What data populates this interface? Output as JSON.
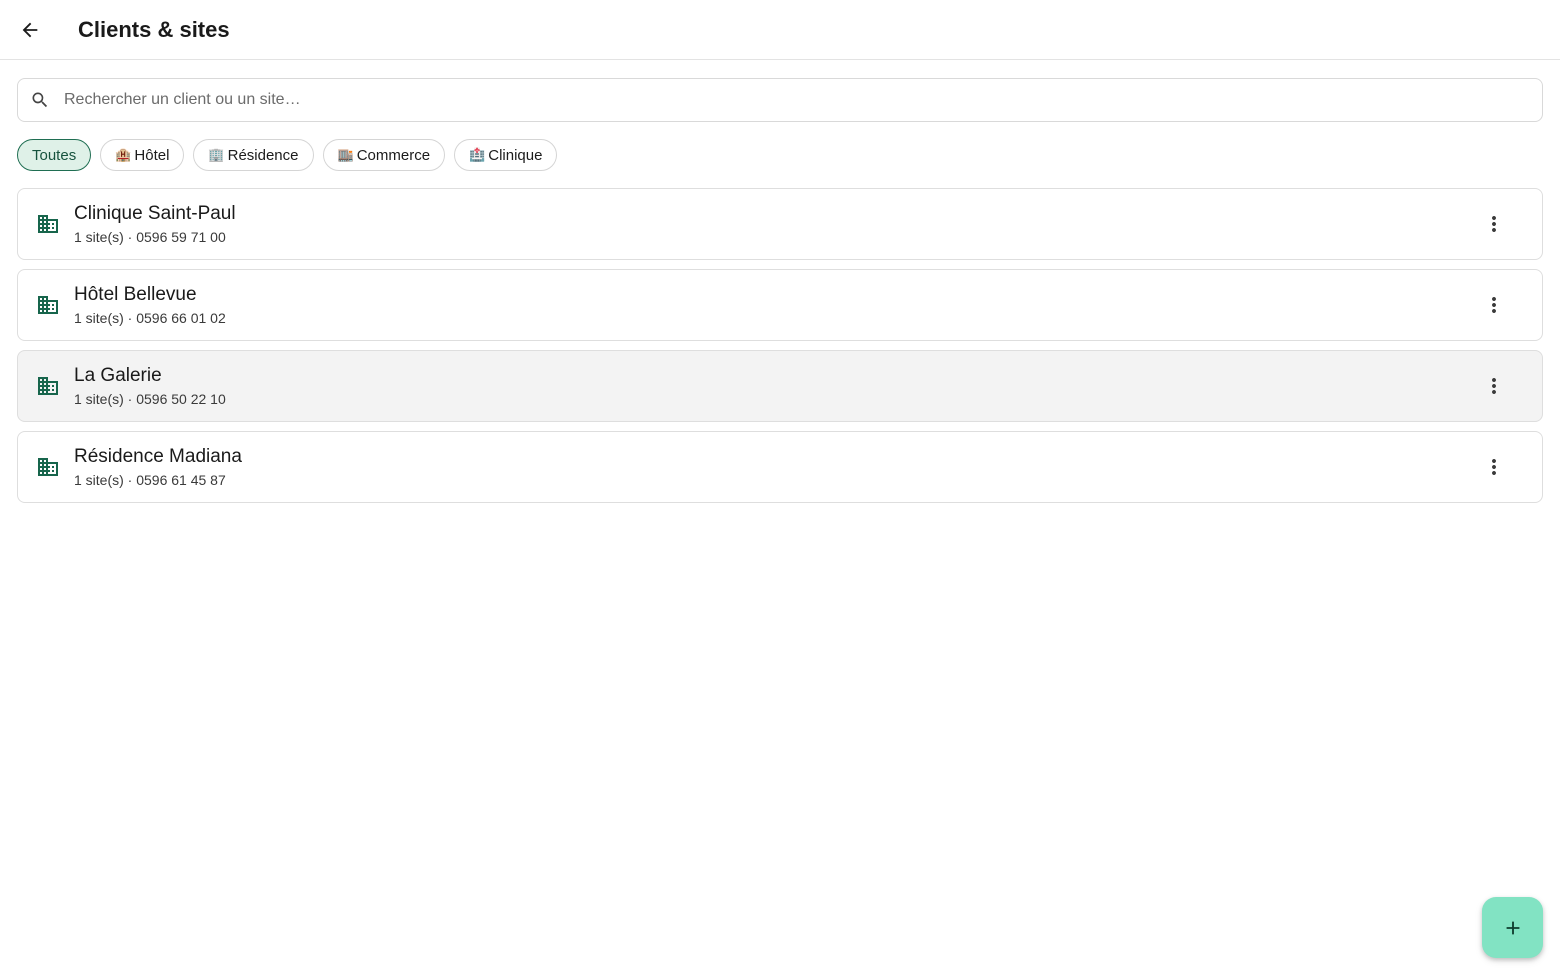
{
  "header": {
    "title": "Clients & sites",
    "back_icon": "arrow-left-icon"
  },
  "search": {
    "placeholder": "Rechercher un client ou un site…",
    "value": "",
    "icon": "search-icon"
  },
  "filters": [
    {
      "emoji": "",
      "label": "Toutes",
      "active": true
    },
    {
      "emoji": "🏨",
      "label": "Hôtel",
      "active": false
    },
    {
      "emoji": "🏢",
      "label": "Résidence",
      "active": false
    },
    {
      "emoji": "🏬",
      "label": "Commerce",
      "active": false
    },
    {
      "emoji": "🏥",
      "label": "Clinique",
      "active": false
    }
  ],
  "clients": [
    {
      "name": "Clinique Saint-Paul",
      "subtitle": "1 site(s) · 0596 59 71 00",
      "icon": "building-icon"
    },
    {
      "name": "Hôtel Bellevue",
      "subtitle": "1 site(s) · 0596 66 01 02",
      "icon": "building-icon"
    },
    {
      "name": "La Galerie",
      "subtitle": "1 site(s) · 0596 50 22 10",
      "icon": "building-icon"
    },
    {
      "name": "Résidence Madiana",
      "subtitle": "1 site(s) · 0596 61 45 87",
      "icon": "building-icon"
    }
  ],
  "fab": {
    "icon": "plus-icon"
  },
  "colors": {
    "accent": "#17654c",
    "chip_active_bg": "#dff1e8",
    "fab_bg": "#82e3c3",
    "hover_row_bg": "#f3f3f3"
  }
}
